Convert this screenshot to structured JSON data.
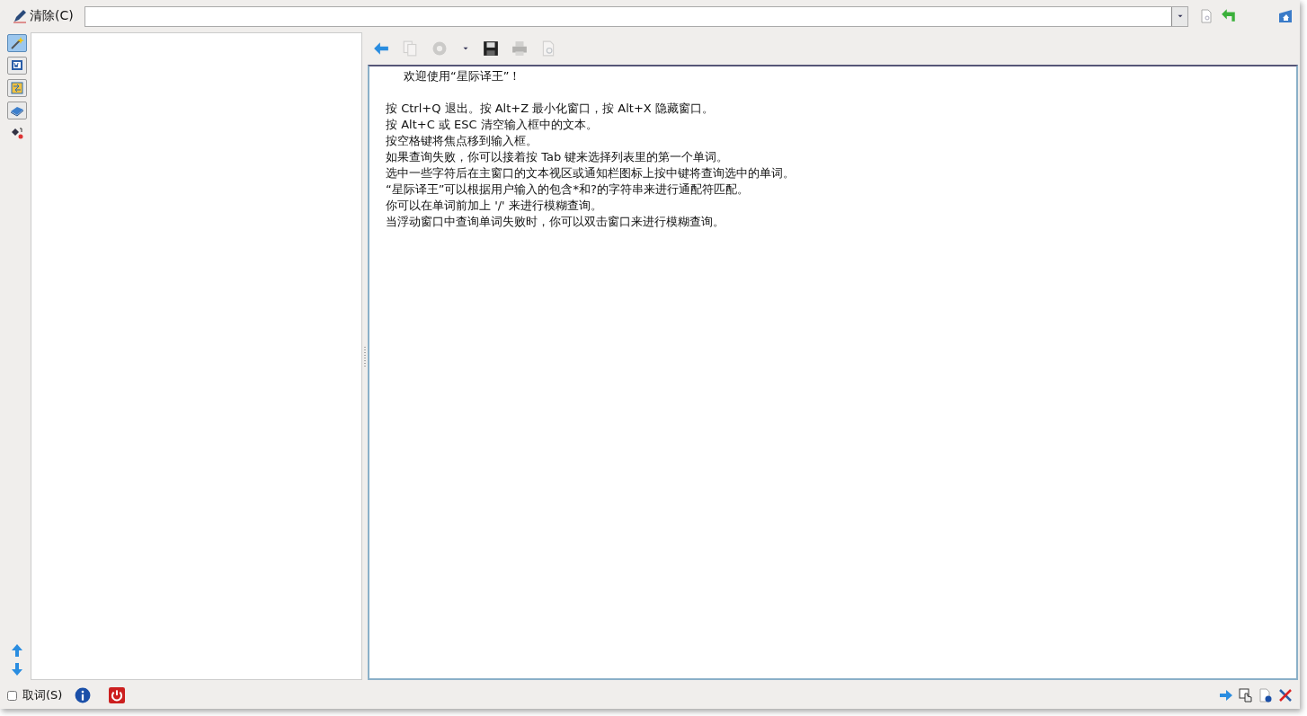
{
  "search_bar": {
    "clear_button": "清除(C)"
  },
  "sidebar": {
    "items": [
      {
        "kind": "wand",
        "selected": true
      },
      {
        "kind": "document",
        "selected": false
      },
      {
        "kind": "book-arrows",
        "selected": false
      },
      {
        "kind": "book",
        "selected": false
      },
      {
        "kind": "fill",
        "selected": false
      }
    ]
  },
  "toolbar": [
    {
      "kind": "back",
      "disabled": false
    },
    {
      "kind": "copy",
      "disabled": true
    },
    {
      "kind": "gear",
      "disabled": true
    },
    {
      "kind": "dropdown",
      "disabled": false
    },
    {
      "kind": "save",
      "disabled": false
    },
    {
      "kind": "print",
      "disabled": true
    },
    {
      "kind": "preview",
      "disabled": true
    }
  ],
  "content": {
    "heading": "欢迎使用“星际译王”！",
    "lines": [
      "按 Ctrl+Q 退出。按 Alt+Z 最小化窗口，按 Alt+X 隐藏窗口。",
      "按 Alt+C 或 ESC 清空输入框中的文本。",
      "按空格键将焦点移到输入框。",
      "如果查询失败，你可以接着按 Tab 键来选择列表里的第一个单词。",
      "选中一些字符后在主窗口的文本视区或通知栏图标上按中键将查询选中的单词。",
      "“星际译王”可以根据用户输入的包含*和?的字符串来进行通配符匹配。",
      "你可以在单词前加上 '/' 来进行模糊查询。",
      "当浮动窗口中查询单词失败时，你可以双击窗口来进行模糊查询。"
    ]
  },
  "status_bar": {
    "scan_checkbox": {
      "label": "取词(S)",
      "checked": false
    }
  }
}
